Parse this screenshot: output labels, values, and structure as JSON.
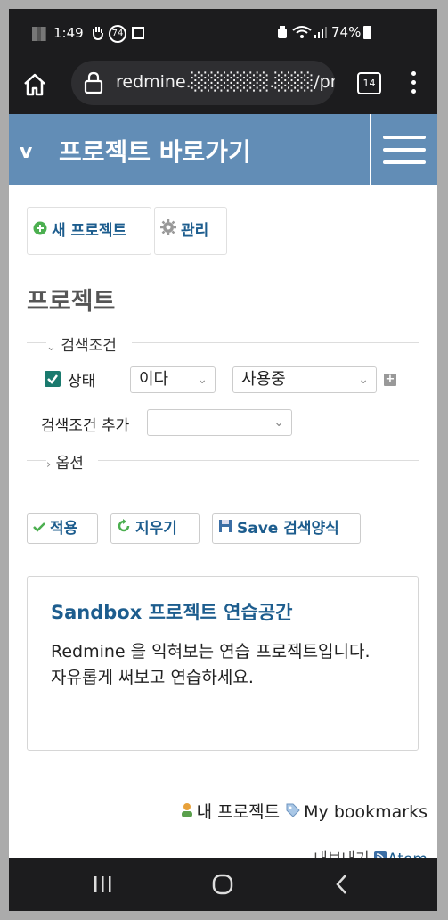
{
  "status_bar": {
    "time": "1:49",
    "notif_badge": "74",
    "battery": "74%"
  },
  "browser": {
    "url": "redmine.░░░░░░.░░░/proj",
    "tab_count": "14"
  },
  "header": {
    "toggle": "v",
    "title": "프로젝트 바로가기"
  },
  "toolbar": {
    "new_project": "새 프로젝트",
    "manage": "관리"
  },
  "page_title": "프로젝트",
  "filters": {
    "legend": "검색조건",
    "status_label": "상태",
    "operator": "이다",
    "value": "사용중",
    "add_filter_label": "검색조건 추가",
    "add_filter_value": ""
  },
  "options": {
    "legend": "옵션"
  },
  "actions": {
    "apply": "적용",
    "clear": "지우기",
    "save": "Save 검색양식"
  },
  "project": {
    "name": "Sandbox 프로젝트 연습공간",
    "description_line1": "Redmine 을 익혀보는 연습 프로젝트입니다.",
    "description_line2": "자유롭게 써보고 연습하세요."
  },
  "footer": {
    "my_projects": "내 프로젝트",
    "bookmarks": "My bookmarks",
    "export": "내보내기",
    "atom": "Atom"
  },
  "colors": {
    "header_bg": "#628db6",
    "link": "#1d5d8e",
    "checkbox": "#1a7a6e"
  }
}
